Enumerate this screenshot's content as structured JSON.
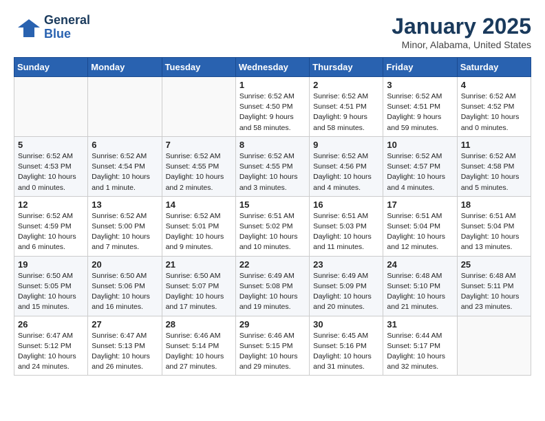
{
  "header": {
    "logo_general": "General",
    "logo_blue": "Blue",
    "month": "January 2025",
    "location": "Minor, Alabama, United States"
  },
  "weekdays": [
    "Sunday",
    "Monday",
    "Tuesday",
    "Wednesday",
    "Thursday",
    "Friday",
    "Saturday"
  ],
  "weeks": [
    [
      {
        "day": "",
        "content": ""
      },
      {
        "day": "",
        "content": ""
      },
      {
        "day": "",
        "content": ""
      },
      {
        "day": "1",
        "content": "Sunrise: 6:52 AM\nSunset: 4:50 PM\nDaylight: 9 hours\nand 58 minutes."
      },
      {
        "day": "2",
        "content": "Sunrise: 6:52 AM\nSunset: 4:51 PM\nDaylight: 9 hours\nand 58 minutes."
      },
      {
        "day": "3",
        "content": "Sunrise: 6:52 AM\nSunset: 4:51 PM\nDaylight: 9 hours\nand 59 minutes."
      },
      {
        "day": "4",
        "content": "Sunrise: 6:52 AM\nSunset: 4:52 PM\nDaylight: 10 hours\nand 0 minutes."
      }
    ],
    [
      {
        "day": "5",
        "content": "Sunrise: 6:52 AM\nSunset: 4:53 PM\nDaylight: 10 hours\nand 0 minutes."
      },
      {
        "day": "6",
        "content": "Sunrise: 6:52 AM\nSunset: 4:54 PM\nDaylight: 10 hours\nand 1 minute."
      },
      {
        "day": "7",
        "content": "Sunrise: 6:52 AM\nSunset: 4:55 PM\nDaylight: 10 hours\nand 2 minutes."
      },
      {
        "day": "8",
        "content": "Sunrise: 6:52 AM\nSunset: 4:55 PM\nDaylight: 10 hours\nand 3 minutes."
      },
      {
        "day": "9",
        "content": "Sunrise: 6:52 AM\nSunset: 4:56 PM\nDaylight: 10 hours\nand 4 minutes."
      },
      {
        "day": "10",
        "content": "Sunrise: 6:52 AM\nSunset: 4:57 PM\nDaylight: 10 hours\nand 4 minutes."
      },
      {
        "day": "11",
        "content": "Sunrise: 6:52 AM\nSunset: 4:58 PM\nDaylight: 10 hours\nand 5 minutes."
      }
    ],
    [
      {
        "day": "12",
        "content": "Sunrise: 6:52 AM\nSunset: 4:59 PM\nDaylight: 10 hours\nand 6 minutes."
      },
      {
        "day": "13",
        "content": "Sunrise: 6:52 AM\nSunset: 5:00 PM\nDaylight: 10 hours\nand 7 minutes."
      },
      {
        "day": "14",
        "content": "Sunrise: 6:52 AM\nSunset: 5:01 PM\nDaylight: 10 hours\nand 9 minutes."
      },
      {
        "day": "15",
        "content": "Sunrise: 6:51 AM\nSunset: 5:02 PM\nDaylight: 10 hours\nand 10 minutes."
      },
      {
        "day": "16",
        "content": "Sunrise: 6:51 AM\nSunset: 5:03 PM\nDaylight: 10 hours\nand 11 minutes."
      },
      {
        "day": "17",
        "content": "Sunrise: 6:51 AM\nSunset: 5:04 PM\nDaylight: 10 hours\nand 12 minutes."
      },
      {
        "day": "18",
        "content": "Sunrise: 6:51 AM\nSunset: 5:04 PM\nDaylight: 10 hours\nand 13 minutes."
      }
    ],
    [
      {
        "day": "19",
        "content": "Sunrise: 6:50 AM\nSunset: 5:05 PM\nDaylight: 10 hours\nand 15 minutes."
      },
      {
        "day": "20",
        "content": "Sunrise: 6:50 AM\nSunset: 5:06 PM\nDaylight: 10 hours\nand 16 minutes."
      },
      {
        "day": "21",
        "content": "Sunrise: 6:50 AM\nSunset: 5:07 PM\nDaylight: 10 hours\nand 17 minutes."
      },
      {
        "day": "22",
        "content": "Sunrise: 6:49 AM\nSunset: 5:08 PM\nDaylight: 10 hours\nand 19 minutes."
      },
      {
        "day": "23",
        "content": "Sunrise: 6:49 AM\nSunset: 5:09 PM\nDaylight: 10 hours\nand 20 minutes."
      },
      {
        "day": "24",
        "content": "Sunrise: 6:48 AM\nSunset: 5:10 PM\nDaylight: 10 hours\nand 21 minutes."
      },
      {
        "day": "25",
        "content": "Sunrise: 6:48 AM\nSunset: 5:11 PM\nDaylight: 10 hours\nand 23 minutes."
      }
    ],
    [
      {
        "day": "26",
        "content": "Sunrise: 6:47 AM\nSunset: 5:12 PM\nDaylight: 10 hours\nand 24 minutes."
      },
      {
        "day": "27",
        "content": "Sunrise: 6:47 AM\nSunset: 5:13 PM\nDaylight: 10 hours\nand 26 minutes."
      },
      {
        "day": "28",
        "content": "Sunrise: 6:46 AM\nSunset: 5:14 PM\nDaylight: 10 hours\nand 27 minutes."
      },
      {
        "day": "29",
        "content": "Sunrise: 6:46 AM\nSunset: 5:15 PM\nDaylight: 10 hours\nand 29 minutes."
      },
      {
        "day": "30",
        "content": "Sunrise: 6:45 AM\nSunset: 5:16 PM\nDaylight: 10 hours\nand 31 minutes."
      },
      {
        "day": "31",
        "content": "Sunrise: 6:44 AM\nSunset: 5:17 PM\nDaylight: 10 hours\nand 32 minutes."
      },
      {
        "day": "",
        "content": ""
      }
    ]
  ]
}
